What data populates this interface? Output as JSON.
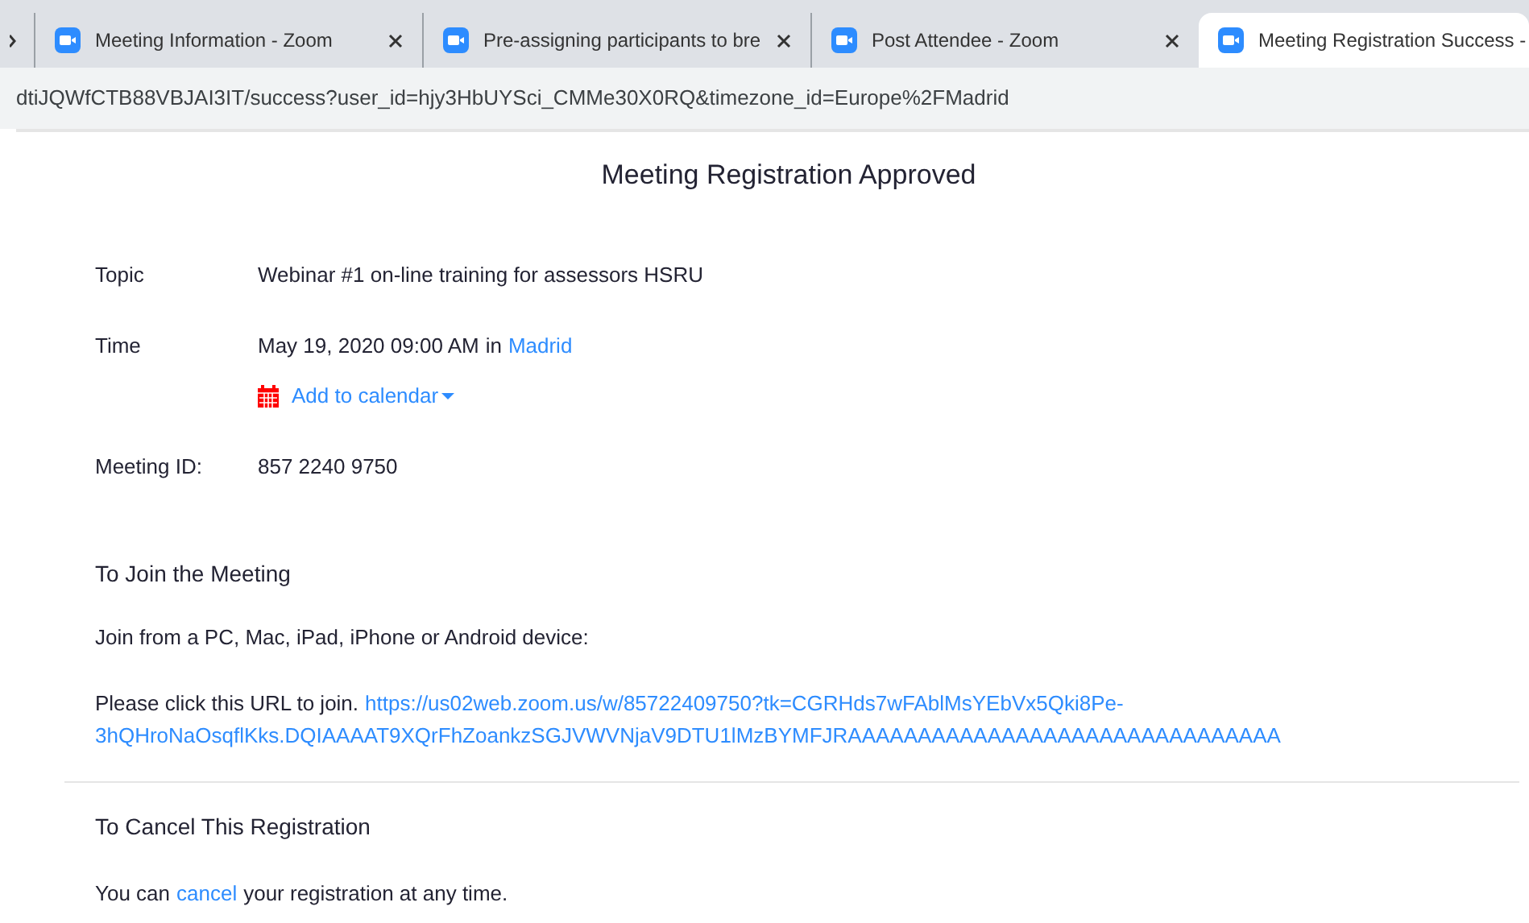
{
  "tabs": [
    {
      "label": "Meeting Information - Zoom",
      "selected": false
    },
    {
      "label": "Pre-assigning participants to bre",
      "selected": false
    },
    {
      "label": "Post Attendee - Zoom",
      "selected": false
    },
    {
      "label": "Meeting Registration Success -",
      "selected": true
    }
  ],
  "address_bar": {
    "url": "dtiJQWfCTB88VBJAI3IT/success?user_id=hjy3HbUYSci_CMMe30X0RQ&timezone_id=Europe%2FMadrid"
  },
  "page": {
    "title": "Meeting Registration Approved",
    "topic": {
      "label": "Topic",
      "value": "Webinar #1 on-line training for assessors HSRU"
    },
    "time": {
      "label": "Time",
      "value": "May 19, 2020 09:00 AM",
      "connector": "in",
      "timezone": "Madrid",
      "calendar": "Add to calendar"
    },
    "meeting_id": {
      "label": "Meeting ID:",
      "value": "857 2240 9750"
    },
    "join": {
      "heading": "To Join the Meeting",
      "devices": "Join from a PC, Mac, iPad, iPhone or Android device:",
      "prompt": "Please click this URL to join.",
      "url_lines": [
        "https://us02web.zoom.us/w/85722409750?tk=CGRHds7wFAblMsYEbVx5Qki8Pe-",
        "3hQHroNaOsqflKks.DQIAAAAT9XQrFhZoankzSGJVWVNjaV9DTU1lMzBYMFJRAAAAAAAAAAAAAAAAAAAAAAAAAAAAAAA"
      ]
    },
    "cancel": {
      "heading": "To Cancel This Registration",
      "before": "You can",
      "link": "cancel",
      "after": "your registration at any time."
    }
  }
}
